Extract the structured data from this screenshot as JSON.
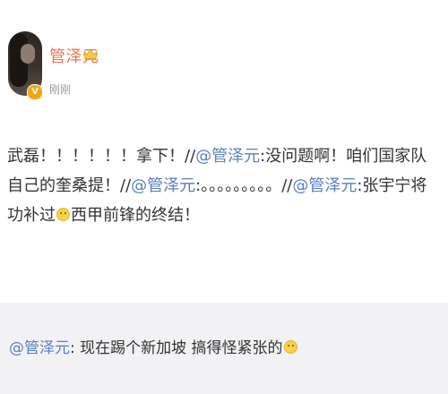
{
  "post": {
    "author": "管泽元",
    "timestamp": "刚刚",
    "content": [
      {
        "type": "text",
        "value": "武磊！！！！！！拿下！//"
      },
      {
        "type": "mention",
        "value": "@管泽元"
      },
      {
        "type": "text",
        "value": ":没问题啊！咱们国家队自己的奎桑提！//"
      },
      {
        "type": "mention",
        "value": "@管泽元"
      },
      {
        "type": "text",
        "value": ":。。。。。。。。。//"
      },
      {
        "type": "mention",
        "value": "@管泽元"
      },
      {
        "type": "text",
        "value": ":张宇宁将功补过"
      },
      {
        "type": "emoji",
        "value": "smile-emoji-icon"
      },
      {
        "type": "text",
        "value": "西甲前锋的终结！"
      }
    ]
  },
  "repost": {
    "author_mention": "@管泽元",
    "text": ": 现在踢个新加坡 搞得怪紧张的",
    "emoji": "smile-emoji-icon"
  },
  "icons": {
    "verified": "verified-v-badge-icon",
    "crown": "crown-icon"
  },
  "colors": {
    "username": "#eb7350",
    "mention": "#5a7fbd",
    "repost_bg": "#f2f2f5",
    "verified_badge": "#f7a413"
  }
}
